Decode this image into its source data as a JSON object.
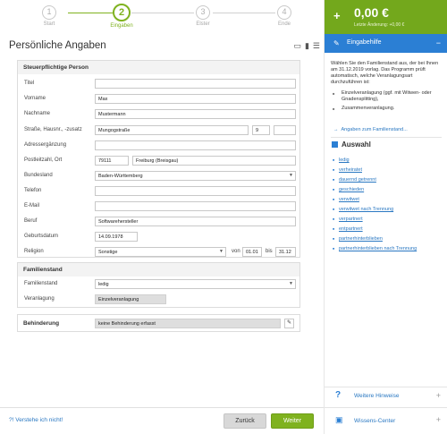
{
  "stepper": {
    "steps": [
      {
        "num": "1",
        "label": "Start"
      },
      {
        "num": "2",
        "label": "Eingaben"
      },
      {
        "num": "3",
        "label": "Elster"
      },
      {
        "num": "4",
        "label": "Ende"
      }
    ]
  },
  "page_title": "Persönliche Angaben",
  "person": {
    "heading": "Steuerpflichtige Person",
    "titel": {
      "label": "Titel",
      "value": ""
    },
    "vorname": {
      "label": "Vorname",
      "value": "Max"
    },
    "nachname": {
      "label": "Nachname",
      "value": "Mustermann"
    },
    "strasse": {
      "label": "Straße, Hausnr., -zusatz",
      "value": "Mungogstraße",
      "hausnr": "9",
      "zusatz": ""
    },
    "adresszusatz": {
      "label": "Adressergänzung",
      "value": ""
    },
    "plz_ort": {
      "label": "Postleitzahl, Ort",
      "plz": "79111",
      "ort": "Freiburg (Breisgau)"
    },
    "bundesland": {
      "label": "Bundesland",
      "value": "Baden-Württemberg"
    },
    "telefon": {
      "label": "Telefon",
      "value": ""
    },
    "email": {
      "label": "E-Mail",
      "value": ""
    },
    "beruf": {
      "label": "Beruf",
      "value": "Softwarehersteller"
    },
    "geburtsdatum": {
      "label": "Geburtsdatum",
      "value": "14.09.1978"
    },
    "religion": {
      "label": "Religion",
      "value": "Sonstige",
      "von_label": "von",
      "von": "01.01",
      "bis_label": "bis",
      "bis": "31.12"
    }
  },
  "familienstand": {
    "heading": "Familienstand",
    "status": {
      "label": "Familienstand",
      "value": "ledig"
    },
    "veranlagung": {
      "label": "Veranlagung",
      "value": "Einzelveranlagung"
    }
  },
  "behinderung": {
    "heading": "Behinderung",
    "value": "keine Behinderung erfasst"
  },
  "bottom": {
    "help_link": "?! Verstehe ich nicht!",
    "back": "Zurück",
    "next": "Weiter"
  },
  "refund": {
    "plus": "+",
    "amount": "0,00 €",
    "last_change": "Letzte Änderung: +0,00 €"
  },
  "help": {
    "heading": "Eingabehilfe",
    "text": "Wählen Sie den Familienstand aus, der bei Ihnen am 31.12.2019 vorlag. Das Programm prüft automatisch, welche Veranlagungsart durchzuführen ist:",
    "bullets": [
      "Einzelveranlagung (ggf. mit Witwen- oder Gnadensplitting),",
      "Zusammenveranlagung."
    ],
    "link": "Angaben zum Familienstand..."
  },
  "auswahl": {
    "heading": "Auswahl",
    "options": [
      "ledig",
      "verheiratet",
      "dauernd getrennt",
      "geschieden",
      "verwitwet",
      "verwitwet nach Trennung",
      "verpartnert",
      "entpartnert",
      "partnerhinterblieben",
      "partnerhinterblieben nach Trennung"
    ]
  },
  "weitere_hinweise": "Weitere Hinweise",
  "wissens_center": "Wissens-Center",
  "colors": {
    "accent_green": "#7fb21f",
    "accent_blue": "#2b7fd4",
    "refund_bg": "#73a81c"
  }
}
